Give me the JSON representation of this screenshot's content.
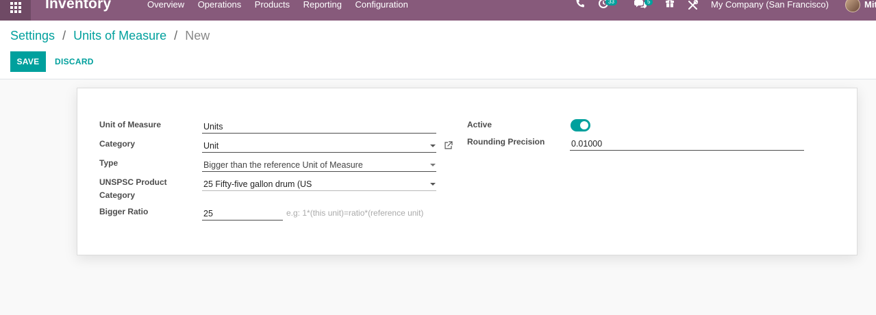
{
  "navbar": {
    "app_name": "Inventory",
    "menu": [
      "Overview",
      "Operations",
      "Products",
      "Reporting",
      "Configuration"
    ],
    "activity_count": "33",
    "message_count": "5",
    "company": "My Company (San Francisco)",
    "user_name": "Mit"
  },
  "breadcrumb": {
    "settings": "Settings",
    "sep1": "/",
    "units": "Units of Measure",
    "sep2": "/",
    "current": "New"
  },
  "actions": {
    "save": "SAVE",
    "discard": "DISCARD"
  },
  "form": {
    "uom_label": "Unit of Measure",
    "uom_value": "Units",
    "category_label": "Category",
    "category_value": "Unit",
    "type_label": "Type",
    "type_value": "Bigger than the reference Unit of Measure",
    "unspsc_label": "UNSPSC Product Category",
    "unspsc_value": "25 Fifty-five gallon drum (US",
    "ratio_label": "Bigger Ratio",
    "ratio_value": "25",
    "ratio_hint": "e.g: 1*(this unit)=ratio*(reference unit)",
    "active_label": "Active",
    "active": true,
    "rounding_label": "Rounding Precision",
    "rounding_value": "0.01000"
  },
  "colors": {
    "brand": "#875a7b",
    "accent": "#00a09d"
  }
}
